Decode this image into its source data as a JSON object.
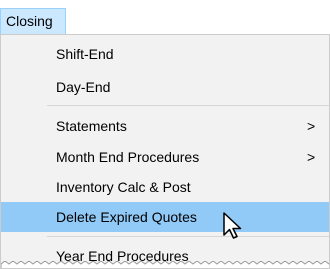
{
  "menubar": {
    "title": "Closing"
  },
  "menu": {
    "items": [
      {
        "label": "Shift-End"
      },
      {
        "label": "Day-End"
      },
      {
        "label": "Statements",
        "submenu_arrow": ">"
      },
      {
        "label": "Month End Procedures",
        "submenu_arrow": ">"
      },
      {
        "label": "Inventory Calc & Post"
      },
      {
        "label": "Delete Expired Quotes",
        "highlighted": true
      },
      {
        "label": "Year End Procedures"
      }
    ]
  },
  "colors": {
    "menubar_active_bg": "#cce8ff",
    "menu_bg": "#f2f2f2",
    "highlight_bg": "#91c9f7"
  },
  "icons": {
    "cursor": "arrow-pointer-icon",
    "submenu": "chevron-right-icon"
  }
}
